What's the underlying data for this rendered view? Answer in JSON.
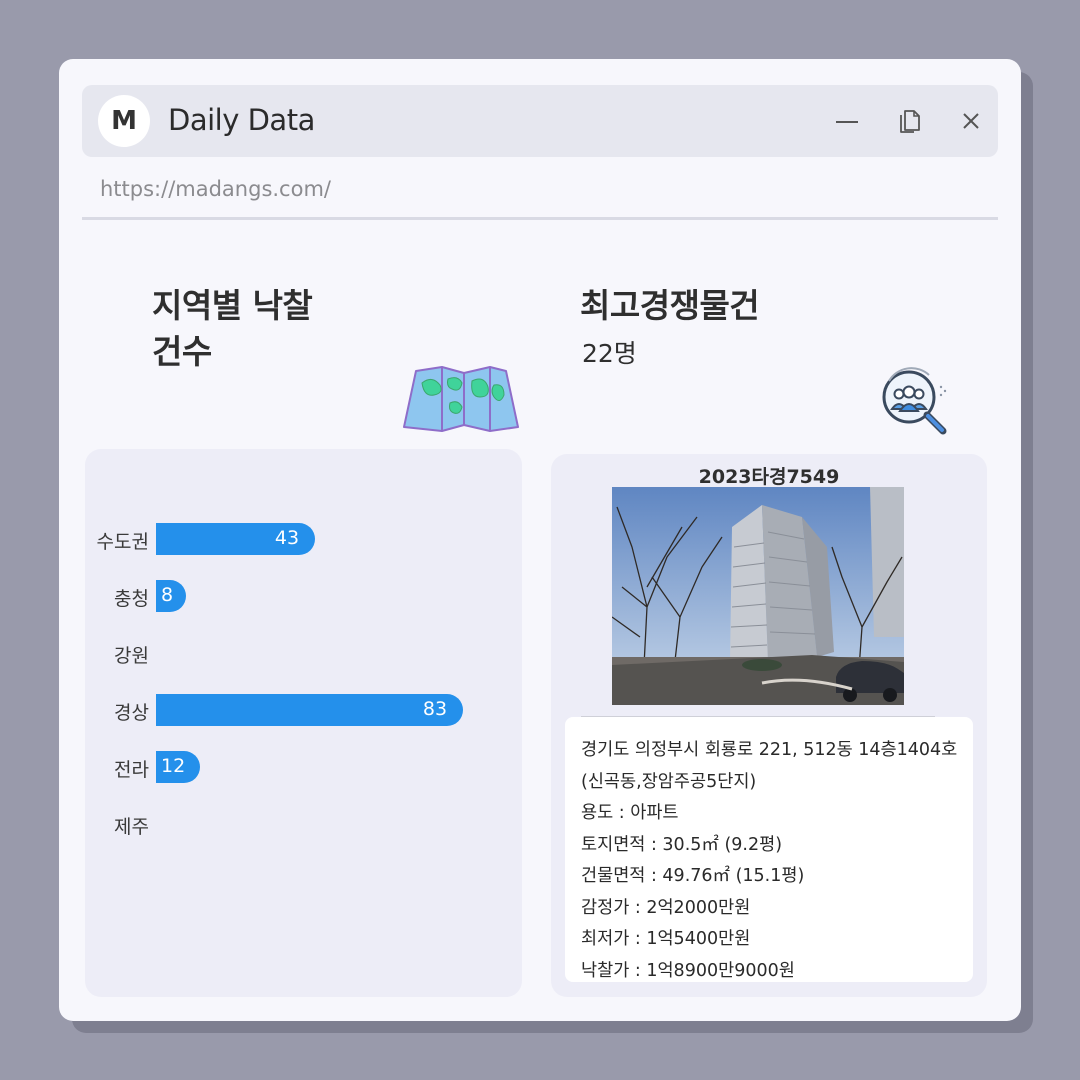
{
  "window": {
    "logo_letter": "M",
    "title": "Daily Data",
    "url": "https://madangs.com/"
  },
  "left_section": {
    "heading_line1": "지역별 낙찰",
    "heading_line2": "건수",
    "icon": "map-icon"
  },
  "right_section": {
    "heading": "최고경쟁물건",
    "subheading": "22명",
    "icon": "people-search-icon"
  },
  "chart_data": {
    "type": "bar",
    "orientation": "horizontal",
    "categories": [
      "수도권",
      "충청",
      "강원",
      "경상",
      "전라",
      "제주"
    ],
    "values": [
      43,
      8,
      0,
      83,
      12,
      0
    ],
    "xlim": [
      0,
      100
    ],
    "grid": false,
    "bar_color": "#2490eb"
  },
  "property": {
    "case_number": "2023타경7549",
    "address_line1": "경기도 의정부시 회룡로 221, 512동 14층1404호",
    "address_line2": "(신곡동,장암주공5단지)",
    "usage": "용도 : 아파트",
    "land_area": "토지면적 : 30.5㎡ (9.2평)",
    "building_area": "건물면적 : 49.76㎡ (15.1평)",
    "appraisal": "감정가 : 2억2000만원",
    "minimum_price": "최저가 : 1억5400만원",
    "winning_bid": "낙찰가 : 1억8900만9000원"
  },
  "colors": {
    "background": "#999aab",
    "bar": "#2490eb",
    "panel": "#ededf7"
  }
}
